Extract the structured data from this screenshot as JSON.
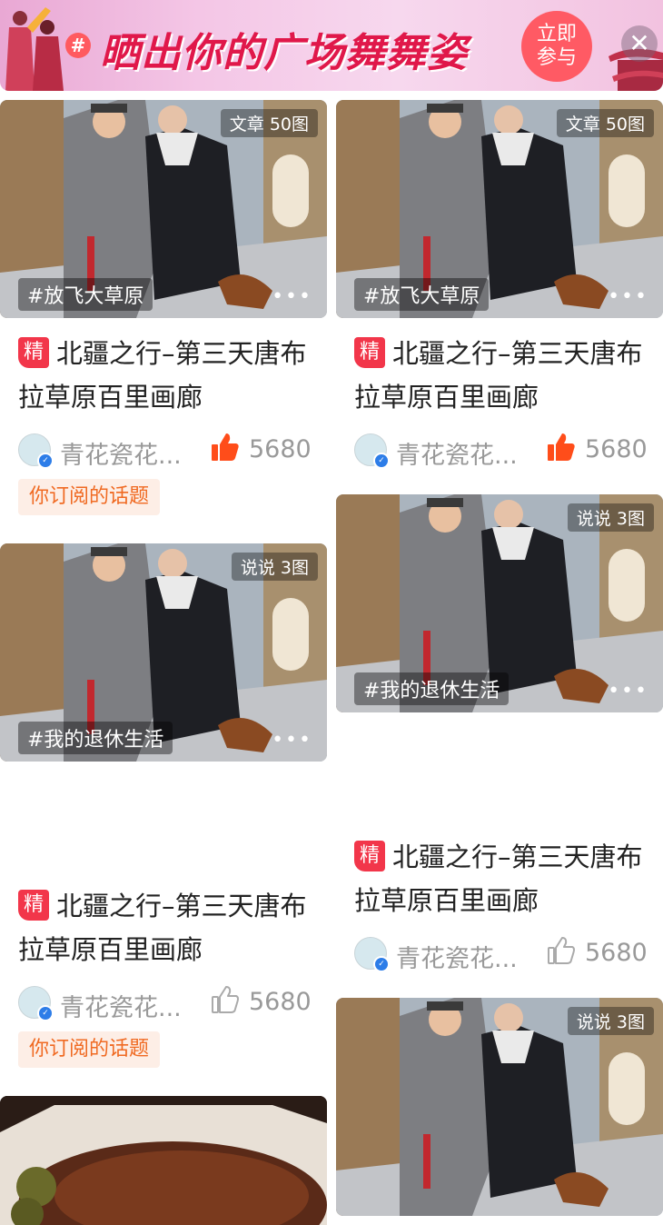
{
  "banner": {
    "hash_symbol": "#",
    "title": "晒出你的广场舞舞姿",
    "join_label": "立即参与",
    "close_symbol": "✕"
  },
  "colors": {
    "accent_red": "#f2364a",
    "like_orange": "#ff4d1a",
    "topic_bg": "#fdeee6",
    "topic_text": "#f06a22"
  },
  "cards": [
    {
      "badge": "文章 50图",
      "tag": "#放飞大草原",
      "featured_label": "精",
      "title": "北疆之行–第三天唐布拉草原百里画廊",
      "author": "青花瓷花...",
      "likes": "5680",
      "liked": true,
      "topic": "你订阅的话题"
    },
    {
      "badge": "文章 50图",
      "tag": "#放飞大草原",
      "featured_label": "精",
      "title": "北疆之行–第三天唐布拉草原百里画廊",
      "author": "青花瓷花...",
      "likes": "5680",
      "liked": true
    },
    {
      "badge": "说说 3图",
      "tag": "#我的退休生活",
      "featured_label": "精",
      "title": "北疆之行–第三天唐布拉草原百里画廊",
      "author": "青花瓷花...",
      "likes": "5680",
      "liked": false,
      "topic": "你订阅的话题"
    },
    {
      "badge": "说说 3图",
      "tag": "#我的退休生活",
      "featured_label": "精",
      "title": "北疆之行–第三天唐布拉草原百里画廊",
      "author": "青花瓷花...",
      "likes": "5680",
      "liked": false
    },
    {
      "badge": "说说 3图"
    }
  ],
  "more_symbol": "•••"
}
